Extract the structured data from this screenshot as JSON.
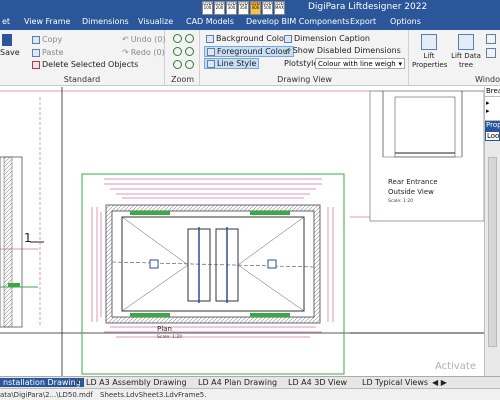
{
  "app": {
    "title": "DigiPara Liftdesigner 2022"
  },
  "menu": {
    "tabs": [
      "et",
      "View Frame",
      "Dimensions",
      "Visualize",
      "CAD Models",
      "Develop BIM Components",
      "Export",
      "Options"
    ]
  },
  "lod": {
    "buttons": [
      "LOD 100",
      "LOD 200",
      "LOD 300",
      "LOD 350",
      "LOD 400",
      "LOD 500",
      "LOD MAX"
    ],
    "active": "LOD 400"
  },
  "ribbon": {
    "standard": {
      "label": "Standard",
      "save": "Save",
      "copy": "Copy",
      "paste": "Paste",
      "delete": "Delete Selected Objects",
      "undo": "Undo (0)",
      "redo": "Redo (0)"
    },
    "zoom": {
      "label": "Zoom"
    },
    "drawing_view": {
      "label": "Drawing View",
      "background_colour": "Background Colour",
      "foreground_colour": "Foreground Colour",
      "line_style": "Line Style",
      "dimension_caption": "Dimension Caption",
      "show_disabled": "Show Disabled Dimensions",
      "plotstyles_label": "Plotstyles",
      "plotstyles_value": "Colour with line weigh"
    },
    "lift": {
      "properties": "Lift Properties",
      "data_tree": "Lift Data tree",
      "window_label": "Windo"
    }
  },
  "drawing": {
    "plan_label": "Plan",
    "plan_scale": "Scale: 1:20",
    "rear_title": "Rear Entrance",
    "rear_sub": "Outside View",
    "rear_scale": "Scale: 1:20",
    "section_marker": "1"
  },
  "side_panel": {
    "header": "Brea",
    "prop": "Prop",
    "look": "Look"
  },
  "sheet_tabs": [
    "nstallation Drawing",
    "LD A3 Assembly Drawing",
    "LD A4 Plan Drawing",
    "LD A4 3D View",
    "LD Typical Views"
  ],
  "status": {
    "path": "ata\\DigiPara\\2...\\LD50.mdf",
    "sheet": "Sheets.LdvSheet3.LdvFrame5."
  },
  "watermark": "Activate",
  "colors": {
    "ribbon_blue": "#2b579a",
    "green_frame": "#3aa845",
    "magenta_dims": "#c0336a",
    "selection": "#c9def5"
  }
}
